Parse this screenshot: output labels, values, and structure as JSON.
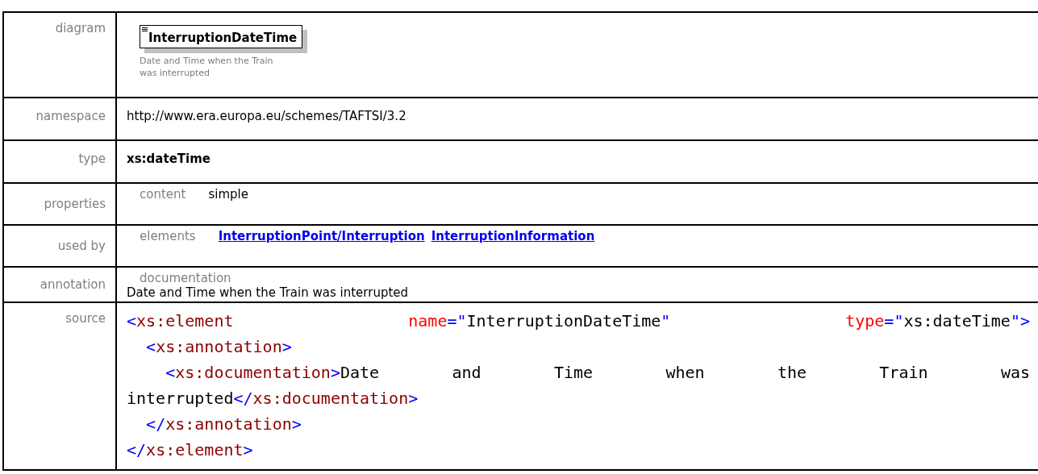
{
  "rows": [
    {
      "label": "diagram",
      "kind": "diagram",
      "element": "InterruptionDateTime",
      "description": "Date and Time when the Train was interrupted"
    },
    {
      "label": "namespace",
      "kind": "text",
      "value": "http://www.era.europa.eu/schemes/TAFTSI/3.2"
    },
    {
      "label": "type",
      "kind": "bold",
      "value": "xs:dateTime"
    },
    {
      "label": "properties",
      "kind": "pairs",
      "pairs": [
        {
          "key": "content",
          "value": "simple"
        }
      ]
    },
    {
      "label": "used by",
      "kind": "links",
      "key": "elements",
      "links": [
        "InterruptionPoint/Interruption",
        "InterruptionInformation"
      ]
    },
    {
      "label": "annotation",
      "kind": "doc",
      "key": "documentation",
      "value": "Date and Time when the Train was interrupted"
    },
    {
      "label": "source",
      "kind": "source",
      "lines": [
        {
          "justify": true,
          "tokens": [
            {
              "kind": "bracket",
              "text": "<"
            },
            {
              "kind": "tag",
              "text": "xs:element"
            },
            {
              "kind": "attr",
              "text": " name"
            },
            {
              "kind": "bracket",
              "text": "=\""
            },
            {
              "kind": "text",
              "text": "InterruptionDateTime"
            },
            {
              "kind": "bracket",
              "text": "\""
            },
            {
              "kind": "attr",
              "text": " type"
            },
            {
              "kind": "bracket",
              "text": "=\""
            },
            {
              "kind": "text",
              "text": "xs:dateTime"
            },
            {
              "kind": "bracket",
              "text": "\">"
            }
          ]
        },
        {
          "tokens": [
            {
              "kind": "bracket",
              "text": "  <"
            },
            {
              "kind": "tag",
              "text": "xs:annotation"
            },
            {
              "kind": "bracket",
              "text": ">"
            }
          ]
        },
        {
          "justify": true,
          "tokens": [
            {
              "kind": "bracket",
              "text": "    <"
            },
            {
              "kind": "tag",
              "text": "xs:documentation"
            },
            {
              "kind": "bracket",
              "text": ">"
            },
            {
              "kind": "text",
              "text": "Date and Time when the Train was"
            }
          ]
        },
        {
          "tokens": [
            {
              "kind": "text",
              "text": "interrupted"
            },
            {
              "kind": "bracket",
              "text": "</"
            },
            {
              "kind": "tag",
              "text": "xs:documentation"
            },
            {
              "kind": "bracket",
              "text": ">"
            }
          ]
        },
        {
          "tokens": [
            {
              "kind": "bracket",
              "text": "  </"
            },
            {
              "kind": "tag",
              "text": "xs:annotation"
            },
            {
              "kind": "bracket",
              "text": ">"
            }
          ]
        },
        {
          "tokens": [
            {
              "kind": "bracket",
              "text": "</"
            },
            {
              "kind": "tag",
              "text": "xs:element"
            },
            {
              "kind": "bracket",
              "text": ">"
            }
          ]
        }
      ]
    }
  ]
}
